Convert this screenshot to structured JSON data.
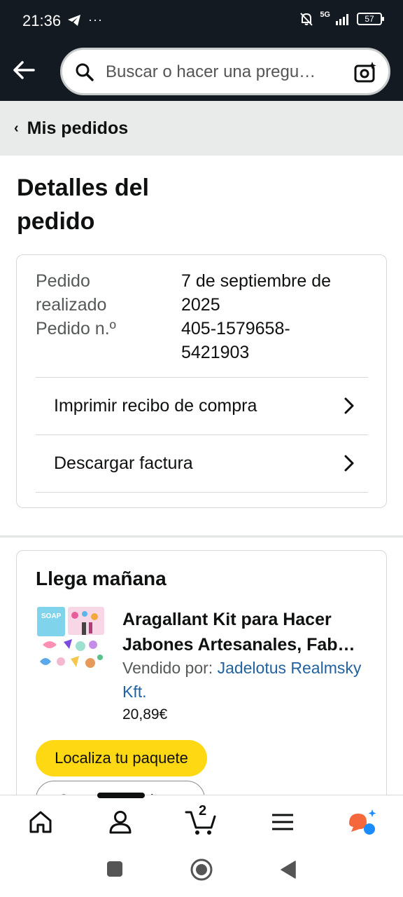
{
  "status_bar": {
    "time": "21:36",
    "network": "5G",
    "battery": "57"
  },
  "search": {
    "placeholder": "Buscar o hacer una pregu…"
  },
  "breadcrumb": {
    "label": "Mis pedidos"
  },
  "page": {
    "title": "Detalles del pedido"
  },
  "summary": {
    "placed_label": "Pedido realizado",
    "placed_value": "7 de septiembre de 2025",
    "number_label": "Pedido n.º",
    "number_value": "405-1579658-5421903",
    "links": [
      {
        "label": "Imprimir recibo de compra"
      },
      {
        "label": "Descargar factura"
      }
    ]
  },
  "shipment": {
    "title": "Llega mañana",
    "product_title": "Aragallant Kit para Hacer Jabones Artesanales, Fab…",
    "sold_by_label": "Vendido por:",
    "seller": "Jadelotus Realmsky Kft.",
    "price": "20,89€",
    "track_button": "Localiza tu paquete",
    "second_button": "Consulta producto"
  },
  "bottom_nav": {
    "cart_count": "2"
  },
  "colors": {
    "header_bg": "#131a22",
    "accent_yellow": "#ffd814",
    "link_blue": "#2162a1",
    "alexa_orange": "#f4683c",
    "alexa_blue": "#1b8cff"
  }
}
